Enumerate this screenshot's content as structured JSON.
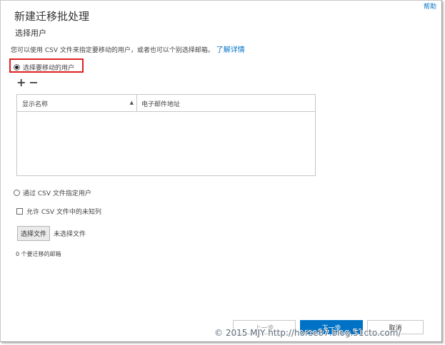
{
  "header": {
    "help": "帮助",
    "title": "新建迁移批处理",
    "subtitle": "选择用户"
  },
  "description": {
    "text": "您可以使用 CSV 文件来指定要移动的用户，或者也可以个别选择邮箱。",
    "link": "了解详情"
  },
  "options": {
    "select_users": "选择要移动的用户",
    "csv_users": "通过 CSV 文件指定用户",
    "allow_unknown": "允许 CSV 文件中的未知列"
  },
  "toolbar": {
    "add": "+",
    "remove": "−"
  },
  "grid": {
    "columns": [
      "显示名称",
      "电子邮件地址"
    ],
    "sort_glyph": "▲",
    "rows": []
  },
  "file": {
    "button": "选择文件",
    "status": "未选择文件"
  },
  "mailbox_count": "0 个要迁移的邮箱",
  "footer": {
    "prev": "上一步",
    "next": "下一步",
    "cancel": "取消"
  },
  "watermark": "© 2015 MJY http://horse87.blog.51cto.com/",
  "colors": {
    "accent": "#0072c6",
    "highlight_border": "#e02020"
  }
}
